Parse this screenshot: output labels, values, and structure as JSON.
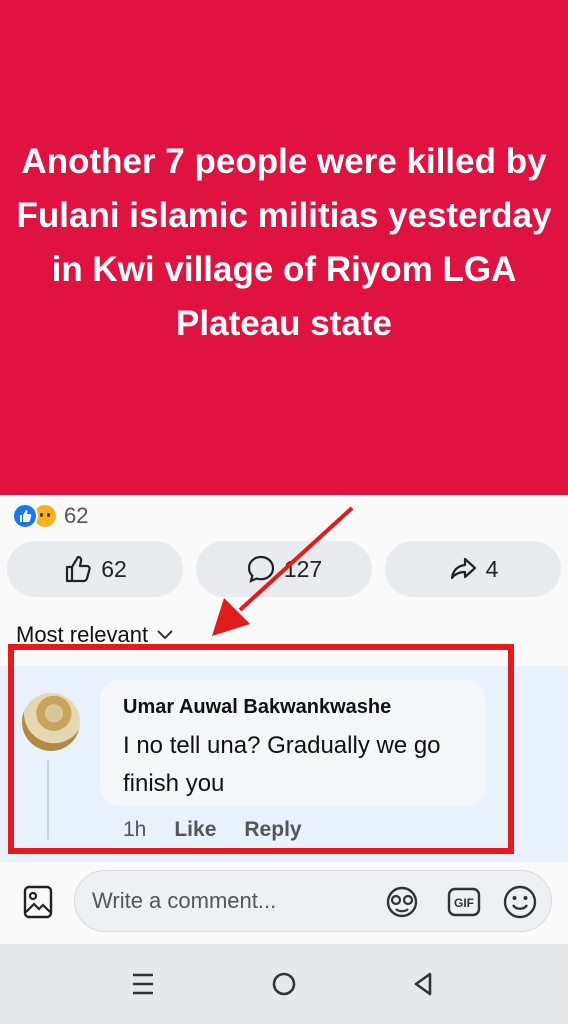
{
  "post": {
    "text": "Another 7 people were killed by Fulani islamic militias yesterday in Kwi village of Riyom LGA Plateau state"
  },
  "reactions": {
    "icons": [
      "like-icon",
      "sad-icon"
    ],
    "count": "62"
  },
  "actions": {
    "like_count": "62",
    "comment_count": "127",
    "share_count": "4"
  },
  "sort": {
    "label": "Most relevant"
  },
  "comment": {
    "author": "Umar Auwal Bakwankwashe",
    "text": "I no tell una? Gradually we go finish you",
    "time": "1h",
    "like_label": "Like",
    "reply_label": "Reply"
  },
  "composer": {
    "placeholder": "Write a comment..."
  },
  "colors": {
    "banner": "#e0123f",
    "highlight": "#e21b1b",
    "like_blue": "#1877f2"
  }
}
